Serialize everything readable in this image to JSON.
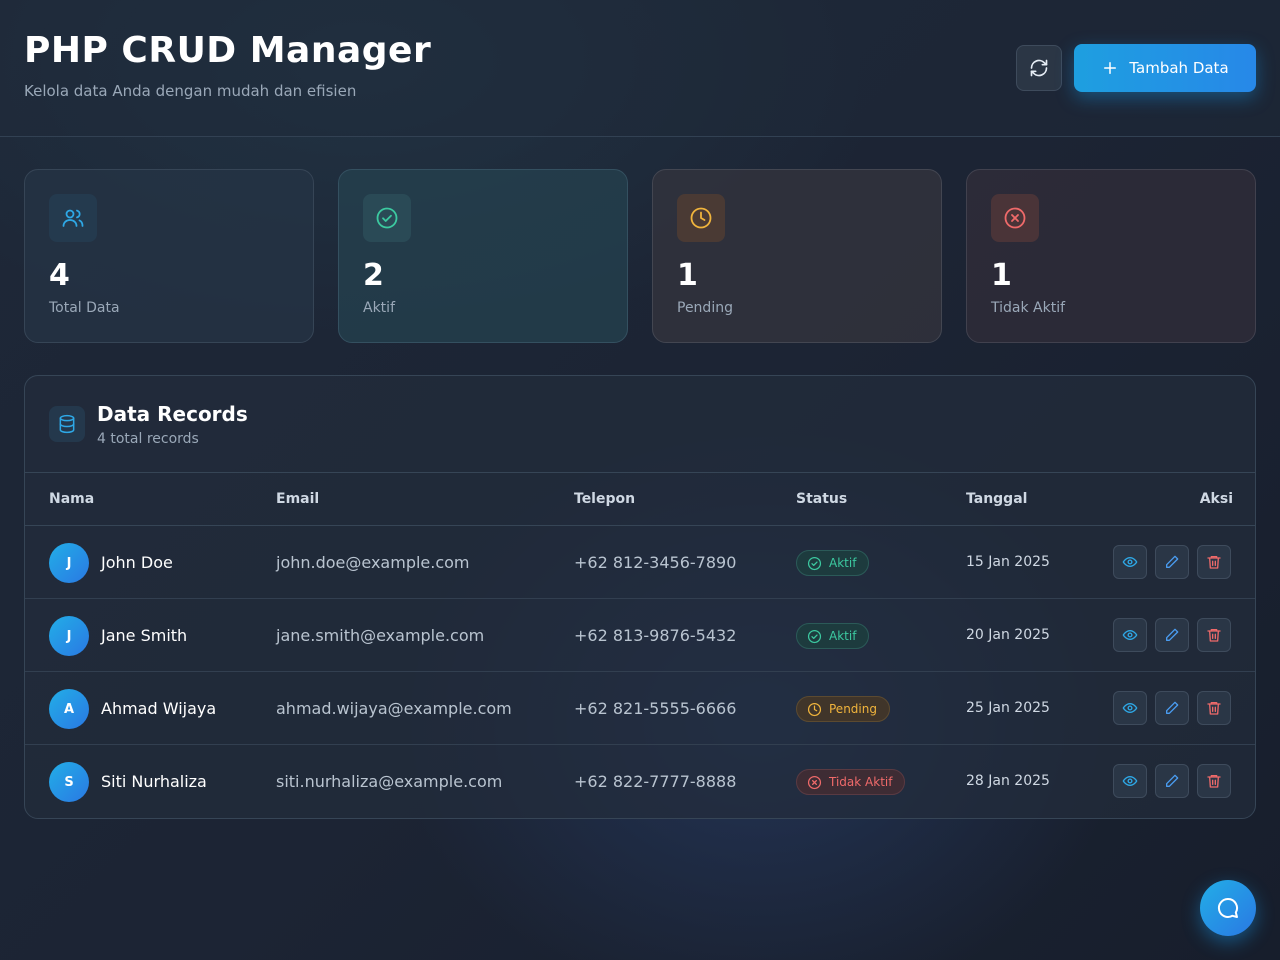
{
  "header": {
    "title": "PHP CRUD Manager",
    "subtitle": "Kelola data Anda dengan mudah dan efisien",
    "refresh_icon": "refresh-icon",
    "add_button_label": "Tambah Data",
    "add_icon": "plus-icon"
  },
  "stats": [
    {
      "value": "4",
      "label": "Total Data",
      "icon": "users-icon",
      "color": "#2ea8e6"
    },
    {
      "value": "2",
      "label": "Aktif",
      "icon": "check-circle-icon",
      "color": "#3cc9a0"
    },
    {
      "value": "1",
      "label": "Pending",
      "icon": "clock-icon",
      "color": "#f0b43c"
    },
    {
      "value": "1",
      "label": "Tidak Aktif",
      "icon": "x-circle-icon",
      "color": "#ef6a6a"
    }
  ],
  "table": {
    "title": "Data Records",
    "subtitle": "4 total records",
    "icon": "database-icon",
    "columns": [
      "Nama",
      "Email",
      "Telepon",
      "Status",
      "Tanggal",
      "Aksi"
    ],
    "rows": [
      {
        "initial": "J",
        "name": "John Doe",
        "email": "john.doe@example.com",
        "phone": "+62 812-3456-7890",
        "status": "Aktif",
        "date": "15 Jan 2025"
      },
      {
        "initial": "J",
        "name": "Jane Smith",
        "email": "jane.smith@example.com",
        "phone": "+62 813-9876-5432",
        "status": "Aktif",
        "date": "20 Jan 2025"
      },
      {
        "initial": "A",
        "name": "Ahmad Wijaya",
        "email": "ahmad.wijaya@example.com",
        "phone": "+62 821-5555-6666",
        "status": "Pending",
        "date": "25 Jan 2025"
      },
      {
        "initial": "S",
        "name": "Siti Nurhaliza",
        "email": "siti.nurhaliza@example.com",
        "phone": "+62 822-7777-8888",
        "status": "Tidak Aktif",
        "date": "28 Jan 2025"
      }
    ],
    "actions": [
      "eye-icon",
      "pencil-icon",
      "trash-icon"
    ]
  },
  "chat_button": {
    "icon": "chat-bubble-icon"
  },
  "colors": {
    "accent": "#1e9fe0",
    "success": "#3cc9a0",
    "warning": "#f0b43c",
    "danger": "#ef6a6a"
  }
}
